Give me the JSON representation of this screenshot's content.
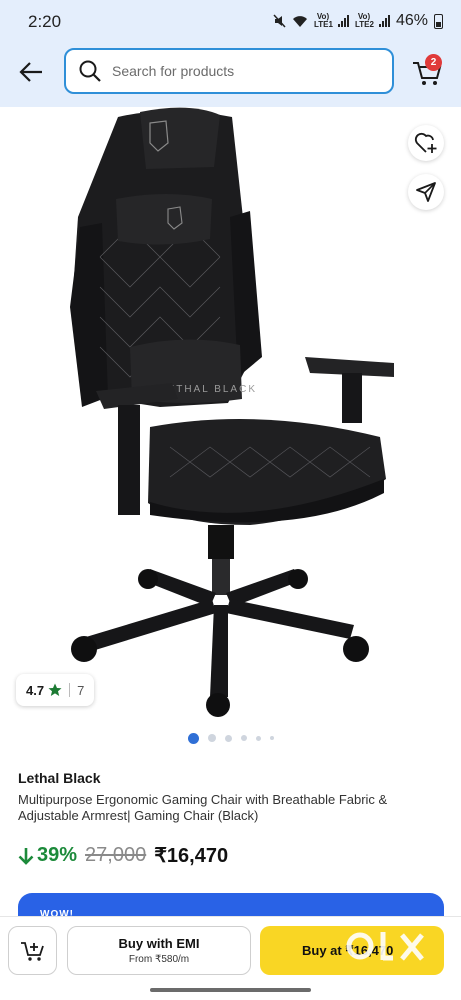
{
  "status_bar": {
    "time": "2:20",
    "sim1_label": "Vo) LTE1",
    "sim2_label": "Vo) LTE2",
    "battery": "46%"
  },
  "header": {
    "search_placeholder": "Search for products",
    "cart_count": "2",
    "icons": [
      "back-arrow-icon",
      "search-icon",
      "cart-icon"
    ]
  },
  "gallery": {
    "image_icon": "gaming-chair-photo",
    "total_images": 6,
    "active_index": 0,
    "rating": {
      "value": "4.7",
      "count": "7"
    }
  },
  "product": {
    "brand": "Lethal Black",
    "title": "Multipurpose Ergonomic Gaming Chair with Breathable Fabric & Adjustable Armrest| Gaming Chair (Black)",
    "discount": "39%",
    "mrp": "27,000",
    "price": "₹16,470"
  },
  "promo": {
    "text": "WOW!"
  },
  "bottom_bar": {
    "emi_label": "Buy with EMI",
    "emi_sub": "From ₹580/m",
    "buy_label": "Buy at ₹16,470",
    "watermark": "OLX"
  },
  "colors": {
    "header_bg": "#e4eefc",
    "search_border": "#2f8fd8",
    "discount": "#1c8a3a",
    "buy_button": "#f9d624",
    "promo": "#2962e6",
    "badge": "#e03a3a",
    "dot_active": "#2f6fd6"
  }
}
